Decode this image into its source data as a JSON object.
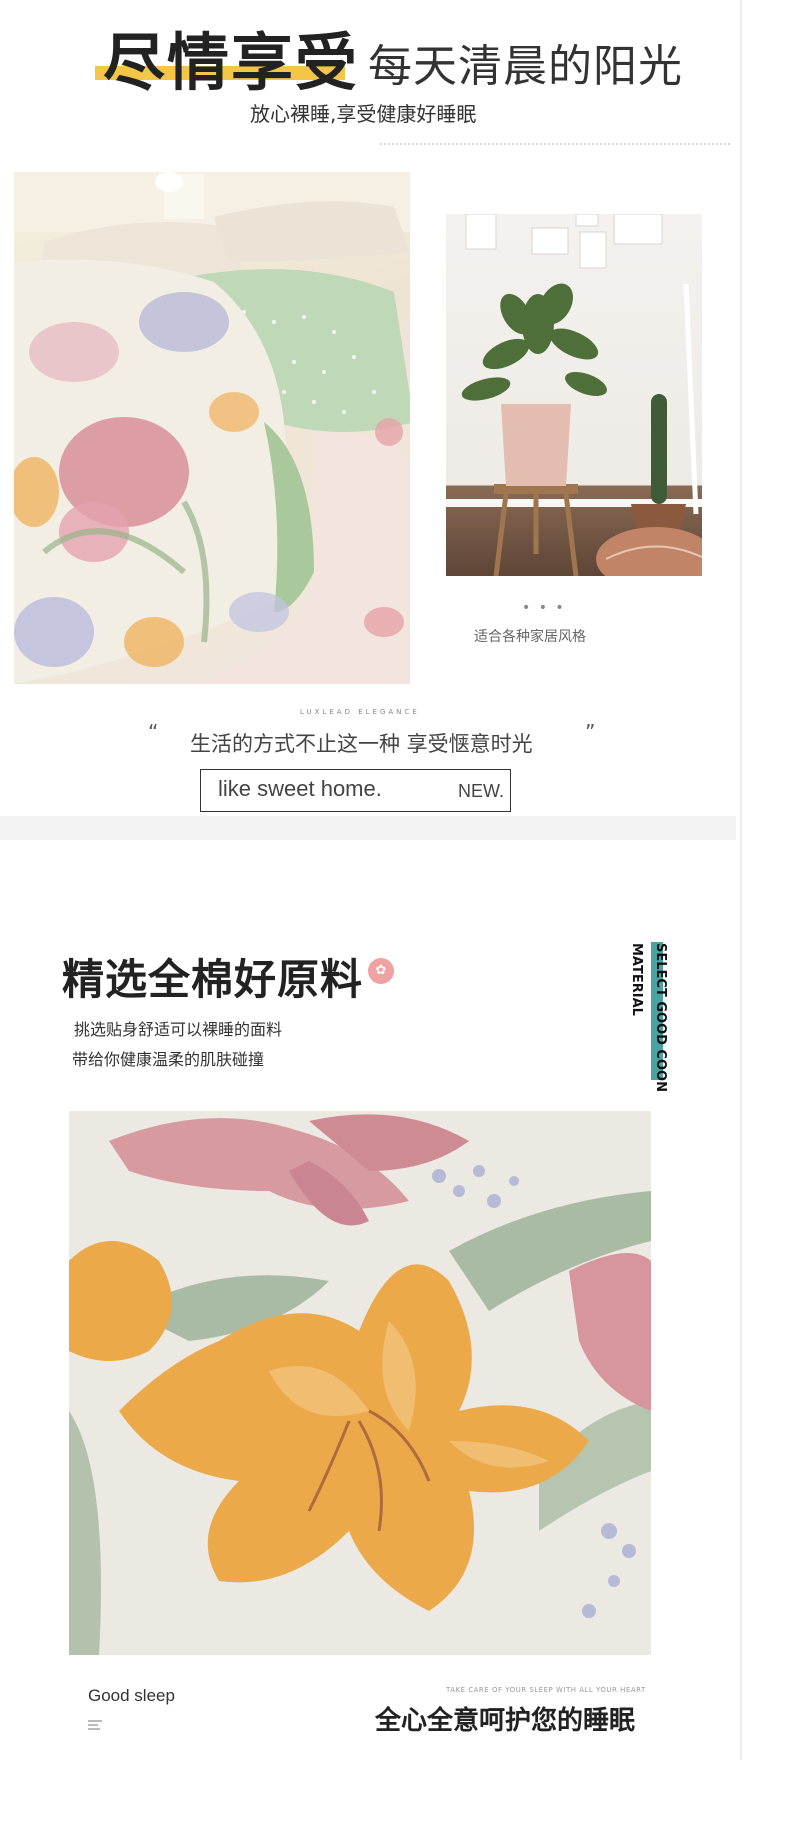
{
  "header": {
    "title": "尽情享受",
    "subtitle": "每天清晨的阳光",
    "description": "放心裸睡,享受健康好睡眠"
  },
  "gallery": {
    "caption_dots": "• • •",
    "caption": "适合各种家居风格"
  },
  "quote": {
    "small_caps": "LUXLEAD ELEGANCE",
    "open_mark": "“",
    "text": "生活的方式不止这一种 享受惬意时光",
    "close_mark": "”",
    "home_text": "like sweet home.",
    "new_text": "NEW."
  },
  "material": {
    "title": "精选全棉好原料",
    "line1": "挑选贴身舒适可以裸睡的面料",
    "line2": "带给你健康温柔的肌肤碰撞",
    "vertical_text1": "SELECT GOOD COON",
    "vertical_text2": "MATERIAL"
  },
  "footer": {
    "good_sleep": "Good sleep",
    "take_care": "TAKE CARE OF YOUR SLEEP WITH ALL YOUR HEART",
    "title": "全心全意呵护您的睡眠"
  },
  "colors": {
    "highlight_yellow": "#f3c64a",
    "accent_teal": "#4aa3a1",
    "badge_pink": "#f0a2a2"
  }
}
